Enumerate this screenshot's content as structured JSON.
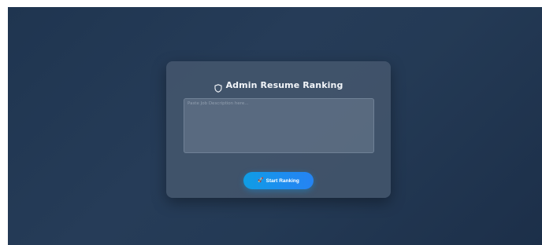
{
  "panel": {
    "title": "Admin Resume Ranking",
    "title_icon": "shield-icon",
    "job_description": {
      "value": "",
      "placeholder": "Paste Job Description here..."
    },
    "start_button": {
      "label": "Start Ranking",
      "icon": "rocket-icon"
    }
  },
  "colors": {
    "background": "#233955",
    "card": "#485a70",
    "button_start": "#0f9de4",
    "button_end": "#2583f2",
    "title_text": "#f2f5f9"
  }
}
